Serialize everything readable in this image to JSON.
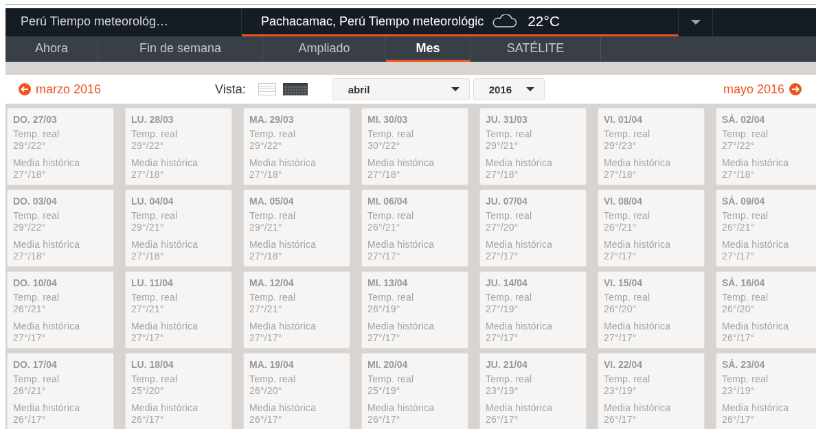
{
  "location_tabs": [
    {
      "label": "Perú Tiempo meteorológ…",
      "selected": false
    },
    {
      "label": "Pachacamac, Perú Tiempo meteorológic",
      "selected": true,
      "temperature": "22°C"
    }
  ],
  "nav_tabs": [
    {
      "label": "Ahora",
      "selected": false
    },
    {
      "label": "Fin de semana",
      "selected": false
    },
    {
      "label": "Ampliado",
      "selected": false
    },
    {
      "label": "Mes",
      "selected": true
    },
    {
      "label": "SATÉLITE",
      "selected": false
    }
  ],
  "calendar": {
    "prev": "marzo 2016",
    "next": "mayo 2016",
    "view_label": "Vista:",
    "views": [
      {
        "kind": "list",
        "selected": false
      },
      {
        "kind": "grid",
        "selected": true
      }
    ],
    "month_select": "abril",
    "year_select": "2016",
    "days": [
      {
        "day": "DO. 27/03",
        "real_label": "Temp. real",
        "real": "29°/22°",
        "avg_label": "Media histórica",
        "avg": "27°/18°"
      },
      {
        "day": "LU. 28/03",
        "real_label": "Temp. real",
        "real": "29°/22°",
        "avg_label": "Media histórica",
        "avg": "27°/18°"
      },
      {
        "day": "MA. 29/03",
        "real_label": "Temp. real",
        "real": "29°/22°",
        "avg_label": "Media histórica",
        "avg": "27°/18°"
      },
      {
        "day": "MI. 30/03",
        "real_label": "Temp. real",
        "real": "30°/22°",
        "avg_label": "Media histórica",
        "avg": "27°/18°"
      },
      {
        "day": "JU. 31/03",
        "real_label": "Temp. real",
        "real": "29°/21°",
        "avg_label": "Media histórica",
        "avg": "27°/18°"
      },
      {
        "day": "VI. 01/04",
        "real_label": "Temp. real",
        "real": "29°/23°",
        "avg_label": "Media histórica",
        "avg": "27°/18°"
      },
      {
        "day": "SÁ. 02/04",
        "real_label": "Temp. real",
        "real": "27°/22°",
        "avg_label": "Media histórica",
        "avg": "27°/18°"
      },
      {
        "day": "DO. 03/04",
        "real_label": "Temp. real",
        "real": "29°/22°",
        "avg_label": "Media histórica",
        "avg": "27°/18°"
      },
      {
        "day": "LU. 04/04",
        "real_label": "Temp. real",
        "real": "29°/21°",
        "avg_label": "Media histórica",
        "avg": "27°/18°"
      },
      {
        "day": "MA. 05/04",
        "real_label": "Temp. real",
        "real": "29°/21°",
        "avg_label": "Media histórica",
        "avg": "27°/18°"
      },
      {
        "day": "MI. 06/04",
        "real_label": "Temp. real",
        "real": "26°/21°",
        "avg_label": "Media histórica",
        "avg": "27°/17°"
      },
      {
        "day": "JU. 07/04",
        "real_label": "Temp. real",
        "real": "27°/20°",
        "avg_label": "Media histórica",
        "avg": "27°/17°"
      },
      {
        "day": "VI. 08/04",
        "real_label": "Temp. real",
        "real": "26°/21°",
        "avg_label": "Media histórica",
        "avg": "27°/17°"
      },
      {
        "day": "SÁ. 09/04",
        "real_label": "Temp. real",
        "real": "26°/21°",
        "avg_label": "Media histórica",
        "avg": "27°/17°"
      },
      {
        "day": "DO. 10/04",
        "real_label": "Temp. real",
        "real": "26°/21°",
        "avg_label": "Media histórica",
        "avg": "27°/17°"
      },
      {
        "day": "LU. 11/04",
        "real_label": "Temp. real",
        "real": "27°/21°",
        "avg_label": "Media histórica",
        "avg": "27°/17°"
      },
      {
        "day": "MA. 12/04",
        "real_label": "Temp. real",
        "real": "27°/21°",
        "avg_label": "Media histórica",
        "avg": "27°/17°"
      },
      {
        "day": "MI. 13/04",
        "real_label": "Temp. real",
        "real": "26°/19°",
        "avg_label": "Media histórica",
        "avg": "27°/17°"
      },
      {
        "day": "JU. 14/04",
        "real_label": "Temp. real",
        "real": "27°/19°",
        "avg_label": "Media histórica",
        "avg": "27°/17°"
      },
      {
        "day": "VI. 15/04",
        "real_label": "Temp. real",
        "real": "26°/20°",
        "avg_label": "Media histórica",
        "avg": "27°/17°"
      },
      {
        "day": "SÁ. 16/04",
        "real_label": "Temp. real",
        "real": "26°/20°",
        "avg_label": "Media histórica",
        "avg": "26°/17°"
      },
      {
        "day": "DO. 17/04",
        "real_label": "Temp. real",
        "real": "26°/21°",
        "avg_label": "Media histórica",
        "avg": "26°/17°"
      },
      {
        "day": "LU. 18/04",
        "real_label": "Temp. real",
        "real": "25°/20°",
        "avg_label": "Media histórica",
        "avg": "26°/17°"
      },
      {
        "day": "MA. 19/04",
        "real_label": "Temp. real",
        "real": "26°/20°",
        "avg_label": "Media histórica",
        "avg": "26°/17°"
      },
      {
        "day": "MI. 20/04",
        "real_label": "Temp. real",
        "real": "25°/19°",
        "avg_label": "Media histórica",
        "avg": "26°/17°"
      },
      {
        "day": "JU. 21/04",
        "real_label": "Temp. real",
        "real": "23°/19°",
        "avg_label": "Media histórica",
        "avg": "26°/17°"
      },
      {
        "day": "VI. 22/04",
        "real_label": "Temp. real",
        "real": "23°/19°",
        "avg_label": "Media histórica",
        "avg": "26°/17°"
      },
      {
        "day": "SÁ. 23/04",
        "real_label": "Temp. real",
        "real": "23°/19°",
        "avg_label": "Media histórica",
        "avg": "26°/17°"
      }
    ]
  }
}
